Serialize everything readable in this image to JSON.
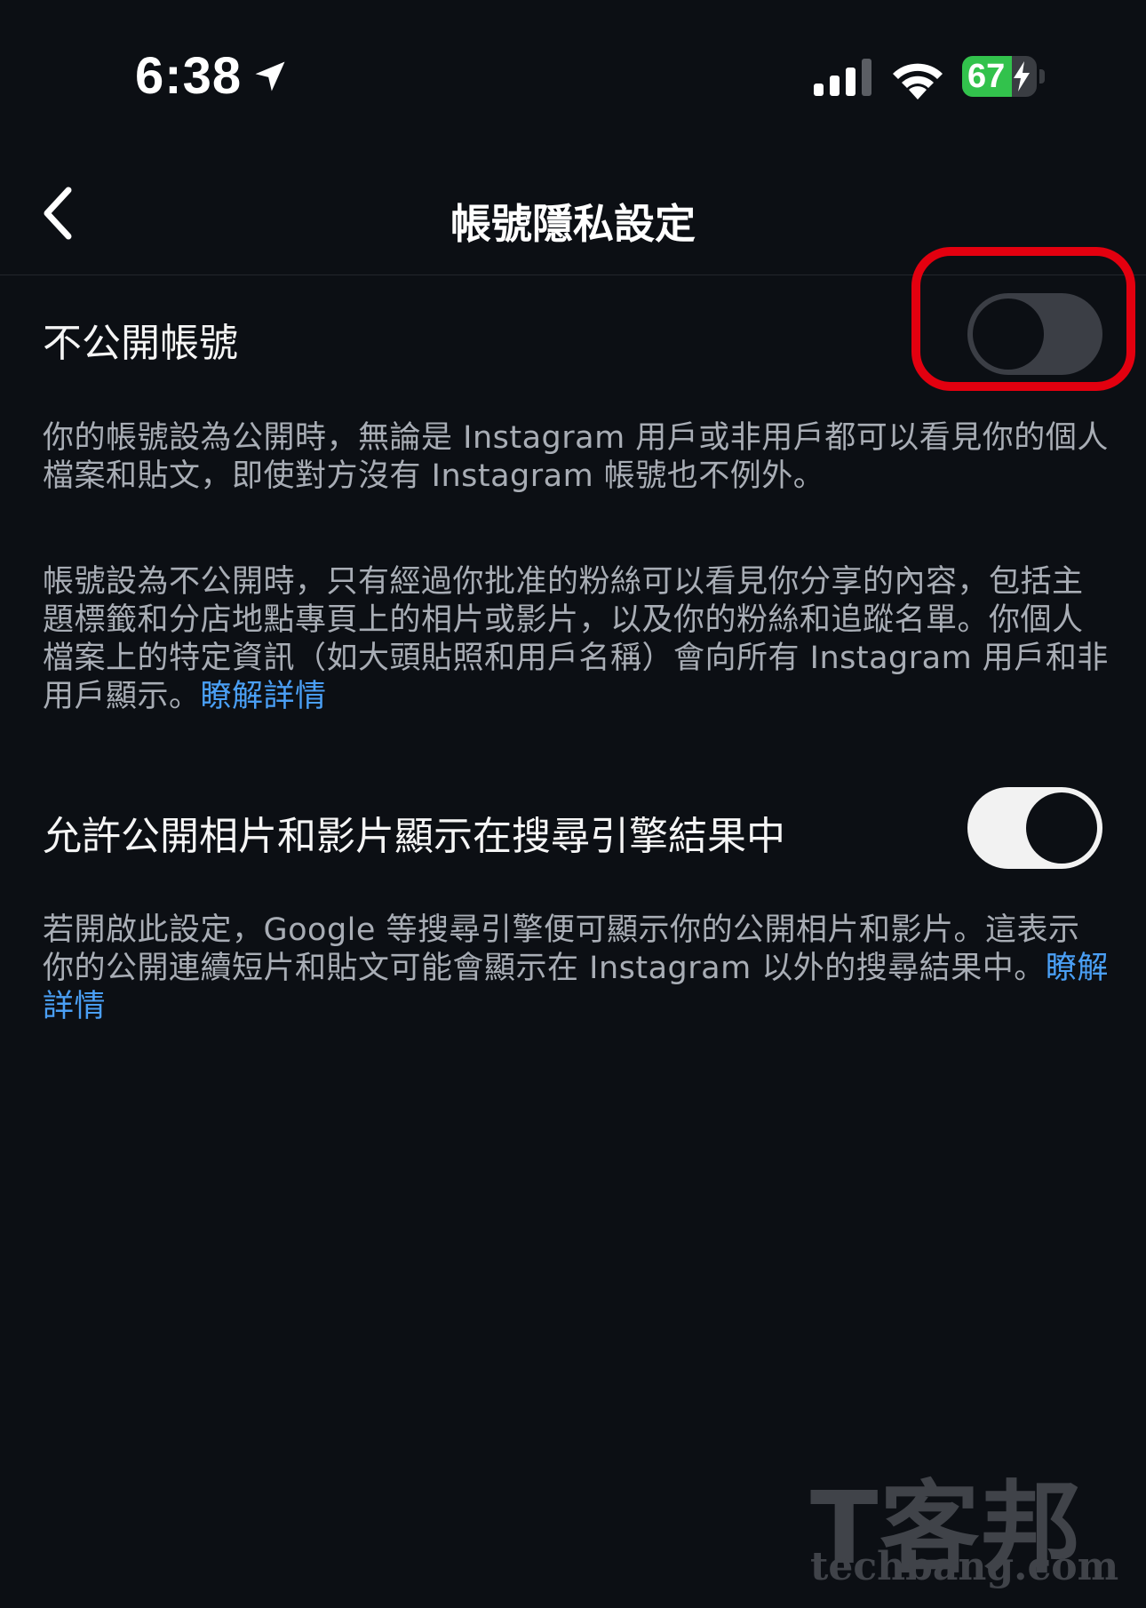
{
  "status_bar": {
    "time": "6:38",
    "battery_level": "67",
    "battery_fraction": 0.67,
    "icons": [
      "location-arrow-icon",
      "cellular-signal-icon",
      "wifi-icon",
      "battery-icon",
      "charging-bolt-icon"
    ]
  },
  "nav": {
    "back_icon": "chevron-left-icon",
    "title": "帳號隱私設定"
  },
  "private_account": {
    "label": "不公開帳號",
    "enabled": false,
    "desc_public": "你的帳號設為公開時，無論是 Instagram 用戶或非用戶都可以看見你的個人檔案和貼文，即使對方沒有 Instagram 帳號也不例外。",
    "desc_private": "帳號設為不公開時，只有經過你批准的粉絲可以看見你分享的內容，包括主題標籤和分店地點專頁上的相片或影片，以及你的粉絲和追蹤名單。你個人檔案上的特定資訊（如大頭貼照和用戶名稱）會向所有 Instagram 用戶和非用戶顯示。",
    "learn_more": "瞭解詳情"
  },
  "search_engine": {
    "label": "允許公開相片和影片顯示在搜尋引擎結果中",
    "enabled": true,
    "desc": "若開啟此設定，Google 等搜尋引擎便可顯示你的公開相片和影片。這表示你的公開連續短片和貼文可能會顯示在 Instagram 以外的搜尋結果中。",
    "learn_more": "瞭解詳情"
  },
  "watermark": {
    "cjk": "T客邦",
    "latin": "techbang.com"
  },
  "colors": {
    "background": "#0c0f14",
    "link": "#4a9ff5",
    "highlight": "#e3000f",
    "battery": "#32c24c"
  }
}
